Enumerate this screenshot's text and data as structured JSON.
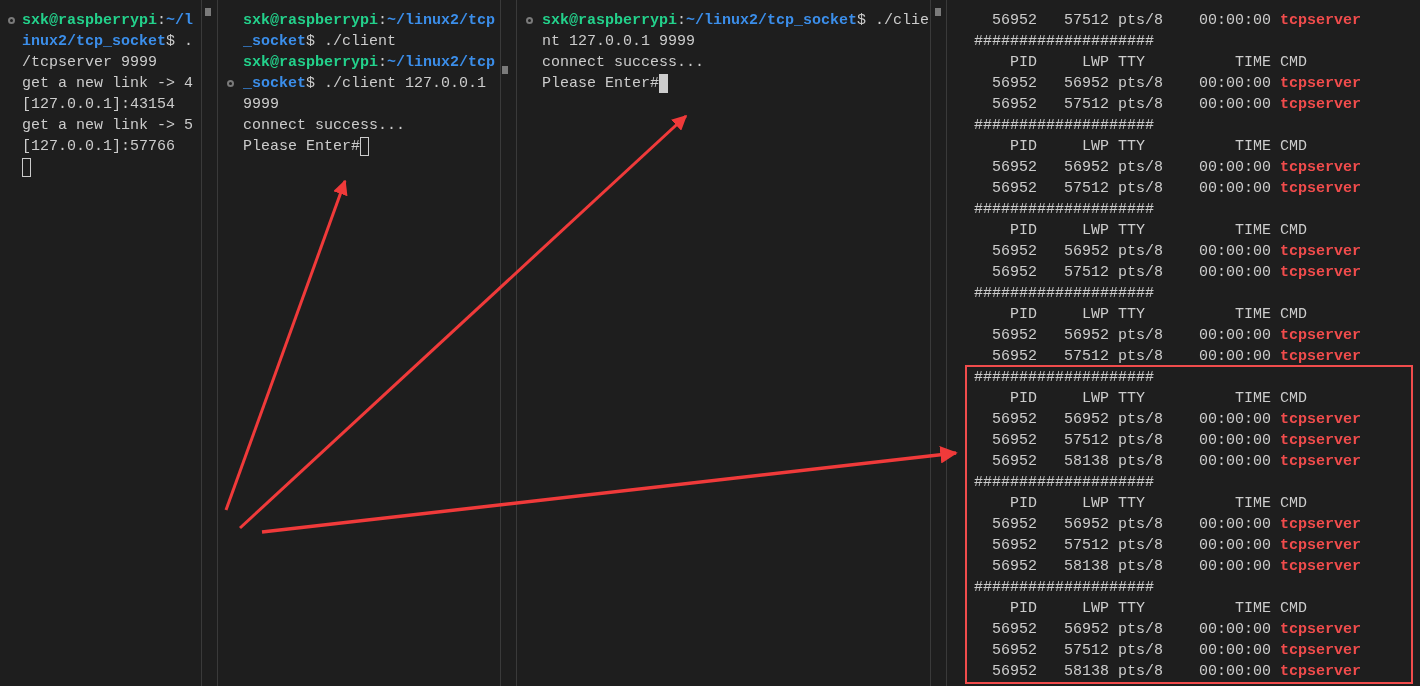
{
  "panes": [
    {
      "lines": [
        {
          "marker": true,
          "segments": [
            {
              "kind": "user",
              "text": "sxk@raspberrypi"
            },
            {
              "kind": "text",
              "text": ":"
            },
            {
              "kind": "path",
              "text": "~/l"
            }
          ]
        },
        {
          "segments": [
            {
              "kind": "path",
              "text": "inux2/tcp_socket"
            },
            {
              "kind": "text",
              "text": "$ ."
            }
          ]
        },
        {
          "segments": [
            {
              "kind": "text",
              "text": "/tcpserver 9999"
            }
          ]
        },
        {
          "segments": [
            {
              "kind": "text",
              "text": "get a new link -> 4"
            }
          ]
        },
        {
          "segments": [
            {
              "kind": "text",
              "text": "[127.0.0.1]:43154"
            }
          ]
        },
        {
          "segments": [
            {
              "kind": "text",
              "text": "get a new link -> 5"
            }
          ]
        },
        {
          "segments": [
            {
              "kind": "text",
              "text": "[127.0.0.1]:57766"
            }
          ]
        },
        {
          "cursor": {
            "focused": false
          }
        }
      ]
    },
    {
      "lines": [
        {
          "segments": [
            {
              "kind": "user",
              "text": "sxk@raspberrypi"
            },
            {
              "kind": "text",
              "text": ":"
            },
            {
              "kind": "path",
              "text": "~/linux2/tcp"
            }
          ]
        },
        {
          "segments": [
            {
              "kind": "path",
              "text": "_socket"
            },
            {
              "kind": "text",
              "text": "$ ./client"
            }
          ]
        },
        {
          "segments": [
            {
              "kind": "user",
              "text": "sxk@raspberrypi"
            },
            {
              "kind": "text",
              "text": ":"
            },
            {
              "kind": "path",
              "text": "~/linux2/tcp"
            }
          ]
        },
        {
          "marker": true,
          "segments": [
            {
              "kind": "path",
              "text": "_socket"
            },
            {
              "kind": "text",
              "text": "$ ./client 127.0.0.1"
            }
          ]
        },
        {
          "segments": [
            {
              "kind": "text",
              "text": "9999"
            }
          ]
        },
        {
          "segments": [
            {
              "kind": "text",
              "text": "connect success..."
            }
          ]
        },
        {
          "segments": [
            {
              "kind": "text",
              "text": "Please Enter#"
            }
          ],
          "cursor": {
            "focused": false
          }
        }
      ]
    },
    {
      "lines": [
        {
          "marker": true,
          "segments": [
            {
              "kind": "user",
              "text": "sxk@raspberrypi"
            },
            {
              "kind": "text",
              "text": ":"
            },
            {
              "kind": "path",
              "text": "~/linux2/tcp_socket"
            },
            {
              "kind": "text",
              "text": "$ ./clie"
            }
          ]
        },
        {
          "segments": [
            {
              "kind": "text",
              "text": "nt 127.0.0.1 9999"
            }
          ]
        },
        {
          "segments": [
            {
              "kind": "text",
              "text": "connect success..."
            }
          ]
        },
        {
          "segments": [
            {
              "kind": "text",
              "text": "Please Enter#"
            }
          ],
          "cursor": {
            "focused": true
          }
        }
      ]
    }
  ],
  "ps_output": {
    "groups": [
      {
        "processes": [
          {
            "pid": "56952",
            "lwp": "57512",
            "tty": "pts/8",
            "time": "00:00:00",
            "cmd": "tcpserver"
          }
        ]
      },
      {
        "separator": "####################",
        "header": [
          "PID",
          "LWP",
          "TTY",
          "TIME",
          "CMD"
        ],
        "processes": [
          {
            "pid": "56952",
            "lwp": "56952",
            "tty": "pts/8",
            "time": "00:00:00",
            "cmd": "tcpserver"
          },
          {
            "pid": "56952",
            "lwp": "57512",
            "tty": "pts/8",
            "time": "00:00:00",
            "cmd": "tcpserver"
          }
        ]
      },
      {
        "separator": "####################",
        "header": [
          "PID",
          "LWP",
          "TTY",
          "TIME",
          "CMD"
        ],
        "processes": [
          {
            "pid": "56952",
            "lwp": "56952",
            "tty": "pts/8",
            "time": "00:00:00",
            "cmd": "tcpserver"
          },
          {
            "pid": "56952",
            "lwp": "57512",
            "tty": "pts/8",
            "time": "00:00:00",
            "cmd": "tcpserver"
          }
        ]
      },
      {
        "separator": "####################",
        "header": [
          "PID",
          "LWP",
          "TTY",
          "TIME",
          "CMD"
        ],
        "processes": [
          {
            "pid": "56952",
            "lwp": "56952",
            "tty": "pts/8",
            "time": "00:00:00",
            "cmd": "tcpserver"
          },
          {
            "pid": "56952",
            "lwp": "57512",
            "tty": "pts/8",
            "time": "00:00:00",
            "cmd": "tcpserver"
          }
        ]
      },
      {
        "separator": "####################",
        "header": [
          "PID",
          "LWP",
          "TTY",
          "TIME",
          "CMD"
        ],
        "processes": [
          {
            "pid": "56952",
            "lwp": "56952",
            "tty": "pts/8",
            "time": "00:00:00",
            "cmd": "tcpserver"
          },
          {
            "pid": "56952",
            "lwp": "57512",
            "tty": "pts/8",
            "time": "00:00:00",
            "cmd": "tcpserver"
          }
        ]
      }
    ],
    "highlighted_groups": [
      {
        "separator": "####################",
        "header": [
          "PID",
          "LWP",
          "TTY",
          "TIME",
          "CMD"
        ],
        "processes": [
          {
            "pid": "56952",
            "lwp": "56952",
            "tty": "pts/8",
            "time": "00:00:00",
            "cmd": "tcpserver"
          },
          {
            "pid": "56952",
            "lwp": "57512",
            "tty": "pts/8",
            "time": "00:00:00",
            "cmd": "tcpserver"
          },
          {
            "pid": "56952",
            "lwp": "58138",
            "tty": "pts/8",
            "time": "00:00:00",
            "cmd": "tcpserver"
          }
        ]
      },
      {
        "separator": "####################",
        "header": [
          "PID",
          "LWP",
          "TTY",
          "TIME",
          "CMD"
        ],
        "processes": [
          {
            "pid": "56952",
            "lwp": "56952",
            "tty": "pts/8",
            "time": "00:00:00",
            "cmd": "tcpserver"
          },
          {
            "pid": "56952",
            "lwp": "57512",
            "tty": "pts/8",
            "time": "00:00:00",
            "cmd": "tcpserver"
          },
          {
            "pid": "56952",
            "lwp": "58138",
            "tty": "pts/8",
            "time": "00:00:00",
            "cmd": "tcpserver"
          }
        ]
      },
      {
        "separator": "####################",
        "header": [
          "PID",
          "LWP",
          "TTY",
          "TIME",
          "CMD"
        ],
        "processes": [
          {
            "pid": "56952",
            "lwp": "56952",
            "tty": "pts/8",
            "time": "00:00:00",
            "cmd": "tcpserver"
          },
          {
            "pid": "56952",
            "lwp": "57512",
            "tty": "pts/8",
            "time": "00:00:00",
            "cmd": "tcpserver"
          },
          {
            "pid": "56952",
            "lwp": "58138",
            "tty": "pts/8",
            "time": "00:00:00",
            "cmd": "tcpserver"
          }
        ]
      }
    ]
  }
}
